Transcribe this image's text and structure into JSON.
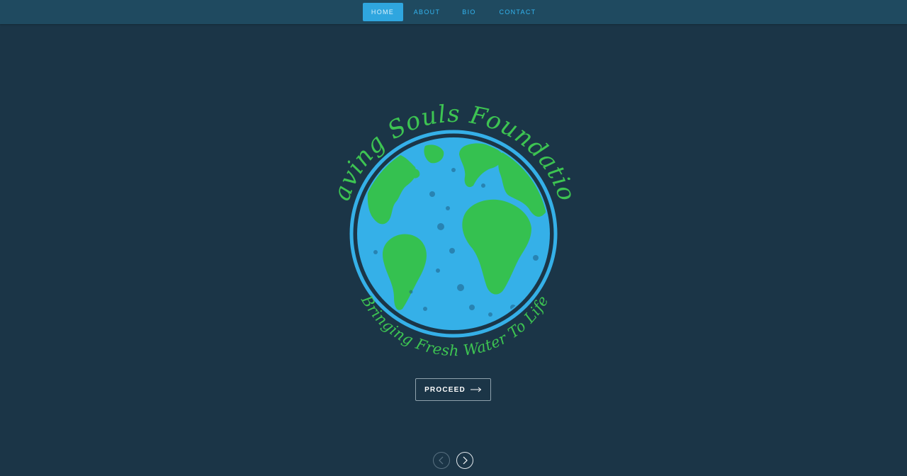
{
  "nav": {
    "items": [
      {
        "label": "HOME",
        "active": true
      },
      {
        "label": "ABOUT",
        "active": false
      },
      {
        "label": "BIO",
        "active": false
      },
      {
        "label": "CONTACT",
        "active": false
      }
    ]
  },
  "logo": {
    "top_text": "Saving Souls Foundation",
    "bottom_text": "Bringing Fresh Water To Life",
    "text_color": "#3dc452",
    "ocean_color": "#35b0e8",
    "land_color": "#35c150"
  },
  "hero": {
    "proceed_label": "PROCEED",
    "proceed_icon": "arrow-right-icon"
  },
  "slider": {
    "prev_icon": "chevron-left-icon",
    "next_icon": "chevron-right-icon"
  },
  "colors": {
    "background": "#1b3547",
    "navbar": "#1f4a60",
    "accent": "#2fa6df"
  }
}
